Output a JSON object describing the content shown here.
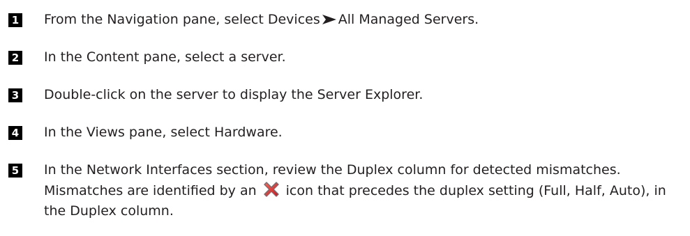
{
  "steps": [
    {
      "number": "1",
      "text_before": "From the Navigation pane, select Devices",
      "arrow_icon": "right-arrowhead-icon",
      "text_after": "All Managed Servers."
    },
    {
      "number": "2",
      "text": "In the Content pane, select a server."
    },
    {
      "number": "3",
      "text": "Double-click on the server to display the Server Explorer."
    },
    {
      "number": "4",
      "text": "In the Views pane, select Hardware."
    },
    {
      "number": "5",
      "text_before": "In the Network Interfaces section, review the Duplex column for detected mismatches. Mismatches are identified by an",
      "icon": "red-x-mismatch-icon",
      "icon_color": "#e0262b",
      "text_after": "icon that precedes the duplex setting (Full, Half, Auto), in the Duplex column."
    }
  ],
  "colors": {
    "text": "#231f20",
    "number_badge_bg": "#000000",
    "number_badge_fg": "#ffffff"
  }
}
